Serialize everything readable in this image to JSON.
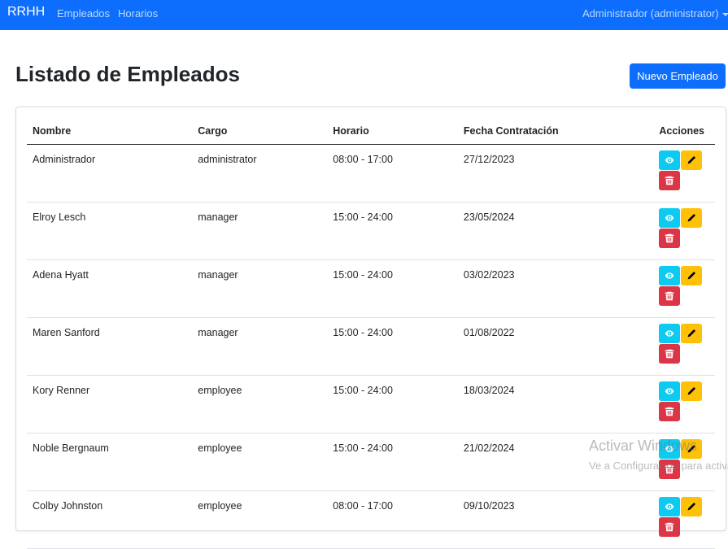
{
  "navbar": {
    "brand": "RRHH",
    "links": [
      "Empleados",
      "Horarios"
    ],
    "user": "Administrador (administrator)"
  },
  "page": {
    "title": "Listado de Empleados",
    "new_button": "Nuevo Empleado"
  },
  "table": {
    "headers": [
      "Nombre",
      "Cargo",
      "Horario",
      "Fecha Contratación",
      "Acciones"
    ],
    "rows": [
      {
        "nombre": "Administrador",
        "cargo": "administrator",
        "horario": "08:00 - 17:00",
        "fecha": "27/12/2023"
      },
      {
        "nombre": "Elroy Lesch",
        "cargo": "manager",
        "horario": "15:00 - 24:00",
        "fecha": "23/05/2024"
      },
      {
        "nombre": "Adena Hyatt",
        "cargo": "manager",
        "horario": "15:00 - 24:00",
        "fecha": "03/02/2023"
      },
      {
        "nombre": "Maren Sanford",
        "cargo": "manager",
        "horario": "15:00 - 24:00",
        "fecha": "01/08/2022"
      },
      {
        "nombre": "Kory Renner",
        "cargo": "employee",
        "horario": "15:00 - 24:00",
        "fecha": "18/03/2024"
      },
      {
        "nombre": "Noble Bergnaum",
        "cargo": "employee",
        "horario": "15:00 - 24:00",
        "fecha": "21/02/2024"
      },
      {
        "nombre": "Colby Johnston",
        "cargo": "employee",
        "horario": "08:00 - 17:00",
        "fecha": "09/10/2023"
      }
    ],
    "action_icons": [
      "eye-icon",
      "pencil-icon",
      "trash-icon"
    ]
  },
  "watermark": {
    "title": "Activar Windows",
    "subtitle": "Ve a Configuración para activar Windows."
  },
  "colors": {
    "primary": "#0d6efd",
    "info": "#0dcaf0",
    "warning": "#ffc107",
    "danger": "#dc3545"
  }
}
